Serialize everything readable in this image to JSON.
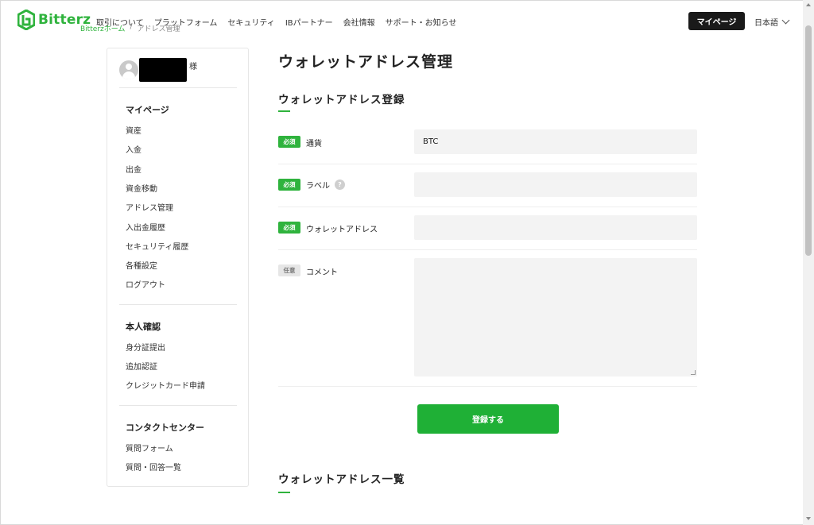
{
  "header": {
    "logo_text": "Bitterz",
    "nav": [
      "取引について",
      "プラットフォーム",
      "セキュリティ",
      "IBパートナー",
      "会社情報",
      "サポート・お知らせ"
    ],
    "breadcrumb": {
      "home": "Bitterzホーム",
      "separator": "/",
      "current": "アドレス管理"
    },
    "mypage_label": "マイページ",
    "language": "日本語"
  },
  "sidebar": {
    "user_suffix": "様",
    "sections": [
      {
        "title": "マイページ",
        "items": [
          "資産",
          "入金",
          "出金",
          "資金移動",
          "アドレス管理",
          "入出金履歴",
          "セキュリティ履歴",
          "各種設定",
          "ログアウト"
        ]
      },
      {
        "title": "本人確認",
        "items": [
          "身分証提出",
          "追加認証",
          "クレジットカード申請"
        ]
      },
      {
        "title": "コンタクトセンター",
        "items": [
          "質問フォーム",
          "質問・回答一覧"
        ]
      }
    ]
  },
  "main": {
    "title": "ウォレットアドレス管理",
    "register_title": "ウォレットアドレス登録",
    "list_title": "ウォレットアドレス一覧",
    "badges": {
      "required": "必須",
      "optional": "任意"
    },
    "fields": {
      "currency": {
        "label": "通貨",
        "value": "BTC"
      },
      "label": {
        "label": "ラベル",
        "help": "?",
        "value": ""
      },
      "address": {
        "label": "ウォレットアドレス",
        "value": ""
      },
      "comment": {
        "label": "コメント",
        "value": ""
      }
    },
    "submit_label": "登録する"
  },
  "colors": {
    "brand_green": "#2fb33d",
    "dark_button": "#1a1a1a"
  }
}
